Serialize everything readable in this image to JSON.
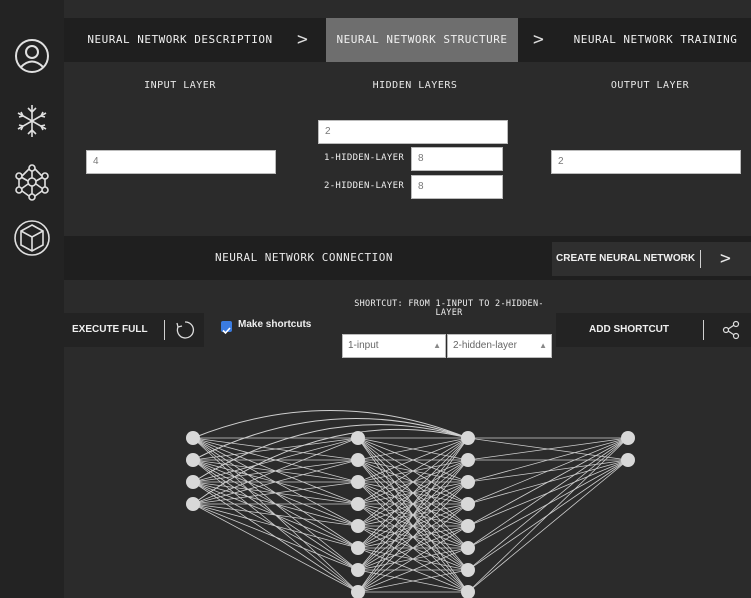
{
  "sidebar": {
    "icons": [
      "user-icon",
      "snowflake-icon",
      "network-icon",
      "cube-icon"
    ]
  },
  "steps": {
    "description": "NEURAL NETWORK DESCRIPTION",
    "structure": "NEURAL NETWORK STRUCTURE",
    "training": "NEURAL NETWORK TRAINING",
    "arrow": ">"
  },
  "layers": {
    "input_header": "INPUT LAYER",
    "hidden_header": "HIDDEN LAYERS",
    "output_header": "OUTPUT LAYER",
    "input_value": "4",
    "hidden_count_value": "2",
    "hidden1_label": "1-HIDDEN-LAYER",
    "hidden1_value": "8",
    "hidden2_label": "2-HIDDEN-LAYER",
    "hidden2_value": "8",
    "output_value": "2"
  },
  "connection": {
    "title": "NEURAL NETWORK CONNECTION",
    "create_label": "CREATE NEURAL NETWORK",
    "create_arrow": ">",
    "execute_label": "EXECUTE FULL",
    "make_shortcuts_label": "Make shortcuts",
    "make_shortcuts_checked": true,
    "shortcut_title": "SHORTCUT: FROM 1-INPUT TO 2-HIDDEN-LAYER",
    "from_select": "1-input",
    "to_select": "2-hidden-layer",
    "add_shortcut_label": "ADD SHORTCUT"
  },
  "network": {
    "layer_sizes": [
      4,
      8,
      8,
      2
    ],
    "shortcut_from_layer": 0,
    "shortcut_to_layer": 2,
    "node_color": "#d8d8d8",
    "edge_color": "#cfcfcf"
  },
  "colors": {
    "background": "#2b2b2b",
    "active_step": "#6e6e6e",
    "checkbox": "#3a7be0"
  }
}
